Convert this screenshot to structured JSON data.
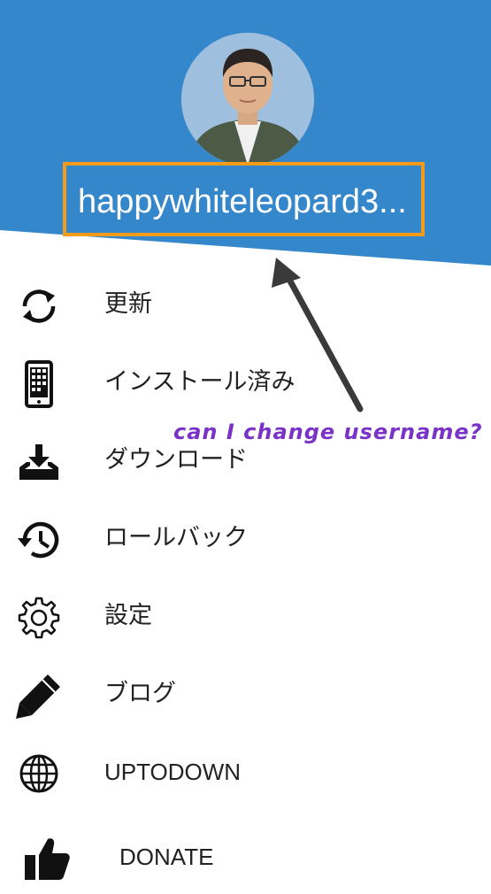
{
  "colors": {
    "header_blue": "#3587cb",
    "highlight_orange": "#f39b1b",
    "annotation_purple": "#7a32c9",
    "text": "#222222"
  },
  "profile": {
    "username": "happywhiteleopard3..."
  },
  "annotation": {
    "text": "can I change username?"
  },
  "menu": {
    "items": [
      {
        "icon": "refresh-icon",
        "label": "更新"
      },
      {
        "icon": "phone-installed-icon",
        "label": "インストール済み"
      },
      {
        "icon": "download-tray-icon",
        "label": "ダウンロード"
      },
      {
        "icon": "history-rollback-icon",
        "label": "ロールバック"
      },
      {
        "icon": "gear-icon",
        "label": "設定"
      },
      {
        "icon": "pencil-icon",
        "label": "ブログ"
      },
      {
        "icon": "globe-icon",
        "label": "UPTODOWN"
      },
      {
        "icon": "thumbs-up-icon",
        "label": "DONATE"
      }
    ]
  }
}
